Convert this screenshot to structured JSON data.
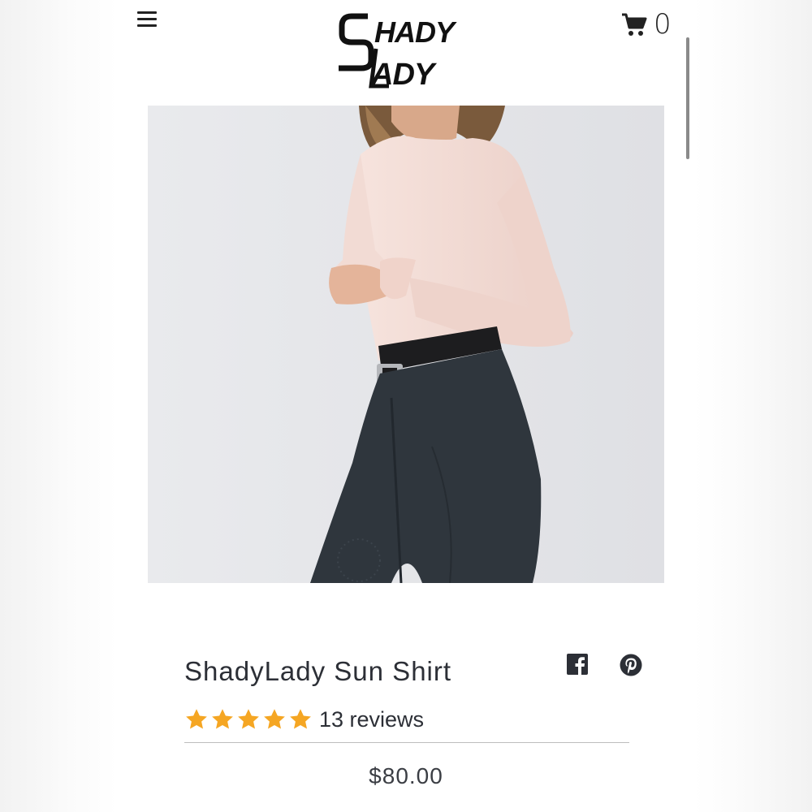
{
  "header": {
    "logo": {
      "line1": "SHADY",
      "line2": "LADY"
    },
    "menu_icon": "hamburger-icon",
    "cart_icon": "shopping-cart-icon",
    "cart_count": "0"
  },
  "product": {
    "image_alt": "Model wearing ShadyLady Sun Shirt",
    "title": "ShadyLady Sun Shirt",
    "rating_stars": 5,
    "rating_max": 5,
    "reviews_text": "13 reviews",
    "price": "$80.00",
    "share": {
      "facebook_icon": "facebook-icon",
      "pinterest_icon": "pinterest-icon"
    }
  },
  "colors": {
    "text": "#2c2f36",
    "star": "#f5a623",
    "shirt": "#f3dcd6",
    "pants": "#2f363d",
    "image_bg": "#e6e7ea"
  }
}
